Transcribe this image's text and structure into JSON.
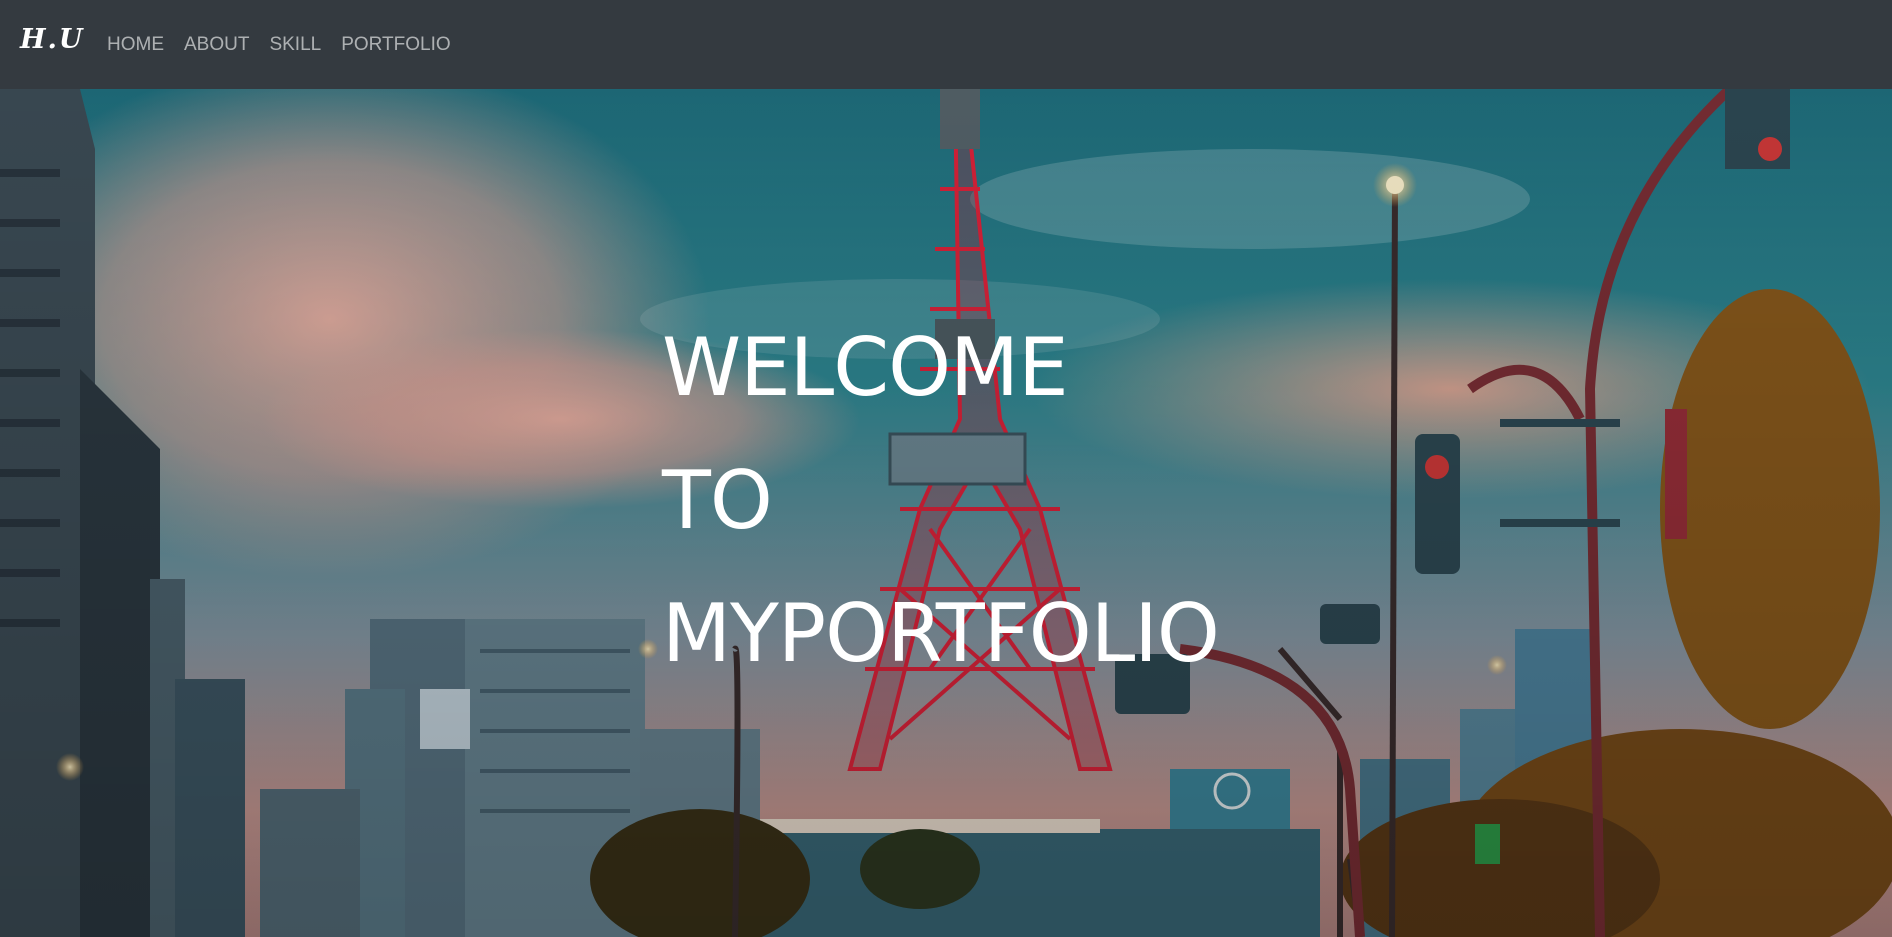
{
  "navbar": {
    "brand": "H.U",
    "links": [
      {
        "label": "HOME"
      },
      {
        "label": "ABOUT"
      },
      {
        "label": "SKILL"
      },
      {
        "label": "PORTFOLIO"
      }
    ]
  },
  "hero": {
    "lines": [
      "WELCOME",
      "TO",
      "MYPORTFOLIO"
    ],
    "background_image": "tokyo-tower-cityscape-dusk"
  },
  "colors": {
    "navbar_bg": "#343a40",
    "nav_link": "#a3a6a9",
    "heading": "#ffffff",
    "tower_red": "#e0233b",
    "sky_teal": "#1f6f7e",
    "cloud_pink": "#e7a79c"
  }
}
